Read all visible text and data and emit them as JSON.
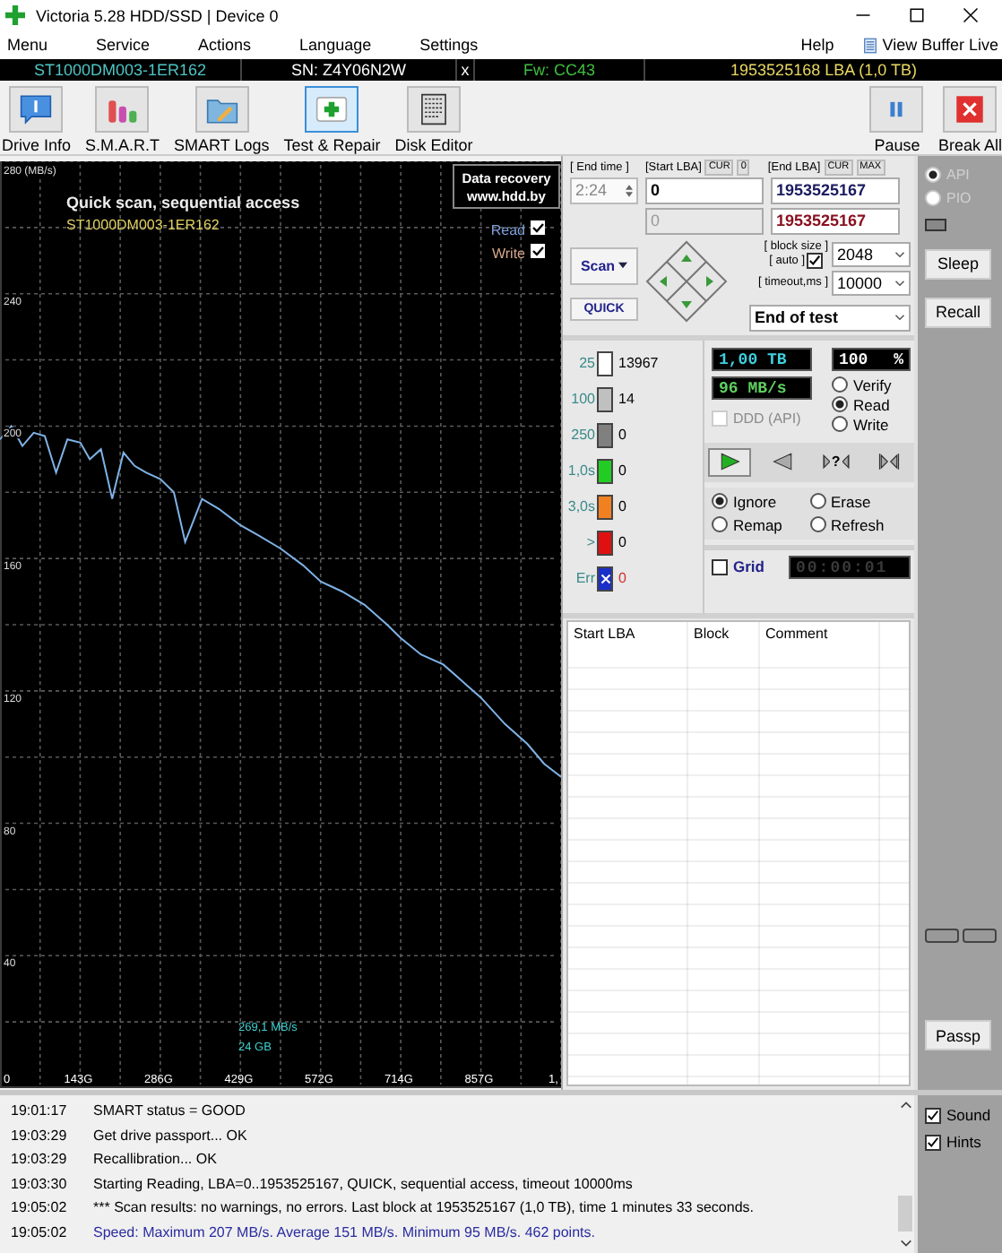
{
  "window": {
    "title": "Victoria 5.28 HDD/SSD | Device 0"
  },
  "menu": {
    "left": [
      "Menu",
      "Service",
      "Actions",
      "Language",
      "Settings"
    ],
    "help": "Help",
    "buffer": "View Buffer Live"
  },
  "drive_bar": {
    "model": "ST1000DM003-1ER162",
    "serial": "SN: Z4Y06N2W",
    "close": "x",
    "firmware": "Fw: CC43",
    "capacity": "1953525168 LBA (1,0 TB)"
  },
  "toolbar": [
    {
      "label": "Drive Info",
      "kind": "info",
      "selected": false
    },
    {
      "label": "S.M.A.R.T",
      "kind": "smart",
      "selected": false
    },
    {
      "label": "SMART Logs",
      "kind": "logs",
      "selected": false
    },
    {
      "label": "Test & Repair",
      "kind": "test",
      "selected": true
    },
    {
      "label": "Disk Editor",
      "kind": "editor",
      "selected": false
    }
  ],
  "toolbar_right": [
    {
      "label": "Pause",
      "kind": "pause"
    },
    {
      "label": "Break All",
      "kind": "break"
    }
  ],
  "chart": {
    "title": "Quick scan, sequential access",
    "drive": "ST1000DM003-1ER162",
    "badge": [
      "Data recovery",
      "www.hdd.by"
    ],
    "legend": [
      {
        "label": "Read",
        "checked": true,
        "color": "#7f9fdc"
      },
      {
        "label": "Write",
        "checked": true,
        "color": "#d8a88c"
      }
    ],
    "cursor": [
      "269,1 MB/s",
      "24 GB"
    ],
    "edge_label": "1,",
    "chart_data": {
      "type": "line",
      "xlim": [
        0,
        1000
      ],
      "ylim": [
        0,
        280
      ],
      "x": [
        0,
        20,
        40,
        60,
        80,
        100,
        120,
        143,
        160,
        180,
        200,
        220,
        240,
        260,
        286,
        310,
        330,
        360,
        390,
        429,
        460,
        500,
        540,
        572,
        610,
        650,
        690,
        714,
        750,
        790,
        830,
        857,
        900,
        940,
        970,
        1000
      ],
      "grid": true,
      "series": [
        {
          "color": "#7fb3e6",
          "values": [
            196,
            200,
            194,
            198,
            197,
            186,
            196,
            195,
            190,
            193,
            178,
            192,
            188,
            186,
            184,
            180,
            165,
            178,
            175,
            170,
            167,
            163,
            158,
            153,
            150,
            146,
            140,
            136,
            131,
            128,
            122,
            118,
            110,
            104,
            98,
            94
          ]
        }
      ],
      "xticks": [
        {
          "value": 0,
          "label": "0"
        },
        {
          "value": 143,
          "label": "143G"
        },
        {
          "value": 286,
          "label": "286G"
        },
        {
          "value": 429,
          "label": "429G"
        },
        {
          "value": 572,
          "label": "572G"
        },
        {
          "value": 714,
          "label": "714G"
        },
        {
          "value": 857,
          "label": "857G"
        }
      ],
      "yticks": [
        40,
        80,
        120,
        160,
        200,
        240,
        {
          "value": 280,
          "label": "280 (MB/s)"
        }
      ]
    }
  },
  "scan": {
    "end_time_label": "[ End time ]",
    "start_label": "[Start LBA]",
    "start_cur": "CUR",
    "start_zero": "0",
    "end_label": "[End LBA]",
    "end_cur": "CUR",
    "end_max": "MAX",
    "end_time": "2:24",
    "start_lba": "0",
    "start_lba_current": "0",
    "end_lba": "1953525167",
    "end_lba_current": "1953525167",
    "scan_button": "Scan",
    "quick_button": "QUICK",
    "block_size_label": "[ block size ]",
    "auto_label": "[ auto ]",
    "auto_checked": true,
    "block_size": "2048",
    "timeout_label": "[ timeout,ms ]",
    "timeout": "10000",
    "on_end": "End of test"
  },
  "blocks": [
    {
      "label": "25",
      "count": "13967",
      "color": "#ffffff",
      "kind": "block"
    },
    {
      "label": "100",
      "count": "14",
      "color": "#c0c0c0",
      "kind": "block"
    },
    {
      "label": "250",
      "count": "0",
      "color": "#808080",
      "kind": "block"
    },
    {
      "label": "1,0s",
      "count": "0",
      "color": "#22cc22",
      "kind": "block"
    },
    {
      "label": "3,0s",
      "count": "0",
      "color": "#f08020",
      "kind": "block"
    },
    {
      "label": ">",
      "count": "0",
      "color": "#e01010",
      "kind": "block"
    },
    {
      "label": "Err",
      "count": "0",
      "color": "#1a2fc8",
      "kind": "error"
    }
  ],
  "status": {
    "done": "1,00 TB",
    "percent": "100",
    "percent_sign": "%",
    "speed": "96 MB/s",
    "ddd": "DDD (API)",
    "ddd_checked": false,
    "ddd_disabled": true
  },
  "mode": [
    {
      "label": "Verify",
      "selected": false
    },
    {
      "label": "Read",
      "selected": true
    },
    {
      "label": "Write",
      "selected": false
    }
  ],
  "playback": [
    {
      "kind": "play",
      "selected": true
    },
    {
      "kind": "back",
      "selected": false
    },
    {
      "kind": "unknown",
      "label": "?",
      "selected": false
    },
    {
      "kind": "skip",
      "selected": false
    }
  ],
  "repair": [
    {
      "label": "Ignore",
      "selected": true
    },
    {
      "label": "Erase",
      "selected": false
    },
    {
      "label": "Remap",
      "selected": false
    },
    {
      "label": "Refresh",
      "selected": false
    }
  ],
  "grid": {
    "label": "Grid",
    "checked": false,
    "timer": "00:00:01"
  },
  "table": {
    "columns": [
      "Start LBA",
      "Block",
      "Comment"
    ]
  },
  "side": {
    "api": {
      "label": "API",
      "selected": true,
      "disabled": true
    },
    "pio": {
      "label": "PIO",
      "selected": false,
      "disabled": true
    },
    "buttons": [
      "Sleep",
      "Recall"
    ],
    "passp": "Passp",
    "options": [
      {
        "label": "Sound",
        "checked": true
      },
      {
        "label": "Hints",
        "checked": true
      }
    ]
  },
  "log": [
    {
      "time": "19:01:17",
      "text": "SMART status = GOOD",
      "kind": "normal"
    },
    {
      "time": "19:03:29",
      "text": "Get drive passport... OK",
      "kind": "normal"
    },
    {
      "time": "19:03:29",
      "text": "Recallibration... OK",
      "kind": "normal"
    },
    {
      "time": "19:03:30",
      "text": "Starting Reading, LBA=0..1953525167, QUICK, sequential access, timeout 10000ms",
      "kind": "normal"
    },
    {
      "time": "19:05:02",
      "text": "*** Scan results: no warnings, no errors. Last block at 1953525167 (1,0 TB), time 1 minutes 33 seconds.",
      "kind": "normal"
    },
    {
      "time": "19:05:02",
      "text": "Speed: Maximum 207 MB/s. Average 151 MB/s. Minimum 95 MB/s. 462 points.",
      "kind": "summary"
    }
  ]
}
